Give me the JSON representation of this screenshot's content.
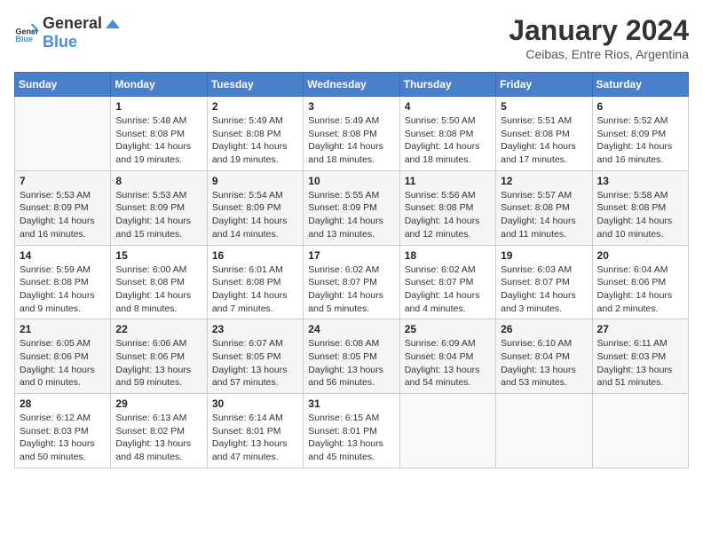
{
  "logo": {
    "general": "General",
    "blue": "Blue"
  },
  "title": "January 2024",
  "subtitle": "Ceibas, Entre Rios, Argentina",
  "days_of_week": [
    "Sunday",
    "Monday",
    "Tuesday",
    "Wednesday",
    "Thursday",
    "Friday",
    "Saturday"
  ],
  "weeks": [
    [
      {
        "day": "",
        "info": ""
      },
      {
        "day": "1",
        "info": "Sunrise: 5:48 AM\nSunset: 8:08 PM\nDaylight: 14 hours\nand 19 minutes."
      },
      {
        "day": "2",
        "info": "Sunrise: 5:49 AM\nSunset: 8:08 PM\nDaylight: 14 hours\nand 19 minutes."
      },
      {
        "day": "3",
        "info": "Sunrise: 5:49 AM\nSunset: 8:08 PM\nDaylight: 14 hours\nand 18 minutes."
      },
      {
        "day": "4",
        "info": "Sunrise: 5:50 AM\nSunset: 8:08 PM\nDaylight: 14 hours\nand 18 minutes."
      },
      {
        "day": "5",
        "info": "Sunrise: 5:51 AM\nSunset: 8:08 PM\nDaylight: 14 hours\nand 17 minutes."
      },
      {
        "day": "6",
        "info": "Sunrise: 5:52 AM\nSunset: 8:09 PM\nDaylight: 14 hours\nand 16 minutes."
      }
    ],
    [
      {
        "day": "7",
        "info": "Sunrise: 5:53 AM\nSunset: 8:09 PM\nDaylight: 14 hours\nand 16 minutes."
      },
      {
        "day": "8",
        "info": "Sunrise: 5:53 AM\nSunset: 8:09 PM\nDaylight: 14 hours\nand 15 minutes."
      },
      {
        "day": "9",
        "info": "Sunrise: 5:54 AM\nSunset: 8:09 PM\nDaylight: 14 hours\nand 14 minutes."
      },
      {
        "day": "10",
        "info": "Sunrise: 5:55 AM\nSunset: 8:09 PM\nDaylight: 14 hours\nand 13 minutes."
      },
      {
        "day": "11",
        "info": "Sunrise: 5:56 AM\nSunset: 8:08 PM\nDaylight: 14 hours\nand 12 minutes."
      },
      {
        "day": "12",
        "info": "Sunrise: 5:57 AM\nSunset: 8:08 PM\nDaylight: 14 hours\nand 11 minutes."
      },
      {
        "day": "13",
        "info": "Sunrise: 5:58 AM\nSunset: 8:08 PM\nDaylight: 14 hours\nand 10 minutes."
      }
    ],
    [
      {
        "day": "14",
        "info": "Sunrise: 5:59 AM\nSunset: 8:08 PM\nDaylight: 14 hours\nand 9 minutes."
      },
      {
        "day": "15",
        "info": "Sunrise: 6:00 AM\nSunset: 8:08 PM\nDaylight: 14 hours\nand 8 minutes."
      },
      {
        "day": "16",
        "info": "Sunrise: 6:01 AM\nSunset: 8:08 PM\nDaylight: 14 hours\nand 7 minutes."
      },
      {
        "day": "17",
        "info": "Sunrise: 6:02 AM\nSunset: 8:07 PM\nDaylight: 14 hours\nand 5 minutes."
      },
      {
        "day": "18",
        "info": "Sunrise: 6:02 AM\nSunset: 8:07 PM\nDaylight: 14 hours\nand 4 minutes."
      },
      {
        "day": "19",
        "info": "Sunrise: 6:03 AM\nSunset: 8:07 PM\nDaylight: 14 hours\nand 3 minutes."
      },
      {
        "day": "20",
        "info": "Sunrise: 6:04 AM\nSunset: 8:06 PM\nDaylight: 14 hours\nand 2 minutes."
      }
    ],
    [
      {
        "day": "21",
        "info": "Sunrise: 6:05 AM\nSunset: 8:06 PM\nDaylight: 14 hours\nand 0 minutes."
      },
      {
        "day": "22",
        "info": "Sunrise: 6:06 AM\nSunset: 8:06 PM\nDaylight: 13 hours\nand 59 minutes."
      },
      {
        "day": "23",
        "info": "Sunrise: 6:07 AM\nSunset: 8:05 PM\nDaylight: 13 hours\nand 57 minutes."
      },
      {
        "day": "24",
        "info": "Sunrise: 6:08 AM\nSunset: 8:05 PM\nDaylight: 13 hours\nand 56 minutes."
      },
      {
        "day": "25",
        "info": "Sunrise: 6:09 AM\nSunset: 8:04 PM\nDaylight: 13 hours\nand 54 minutes."
      },
      {
        "day": "26",
        "info": "Sunrise: 6:10 AM\nSunset: 8:04 PM\nDaylight: 13 hours\nand 53 minutes."
      },
      {
        "day": "27",
        "info": "Sunrise: 6:11 AM\nSunset: 8:03 PM\nDaylight: 13 hours\nand 51 minutes."
      }
    ],
    [
      {
        "day": "28",
        "info": "Sunrise: 6:12 AM\nSunset: 8:03 PM\nDaylight: 13 hours\nand 50 minutes."
      },
      {
        "day": "29",
        "info": "Sunrise: 6:13 AM\nSunset: 8:02 PM\nDaylight: 13 hours\nand 48 minutes."
      },
      {
        "day": "30",
        "info": "Sunrise: 6:14 AM\nSunset: 8:01 PM\nDaylight: 13 hours\nand 47 minutes."
      },
      {
        "day": "31",
        "info": "Sunrise: 6:15 AM\nSunset: 8:01 PM\nDaylight: 13 hours\nand 45 minutes."
      },
      {
        "day": "",
        "info": ""
      },
      {
        "day": "",
        "info": ""
      },
      {
        "day": "",
        "info": ""
      }
    ]
  ]
}
